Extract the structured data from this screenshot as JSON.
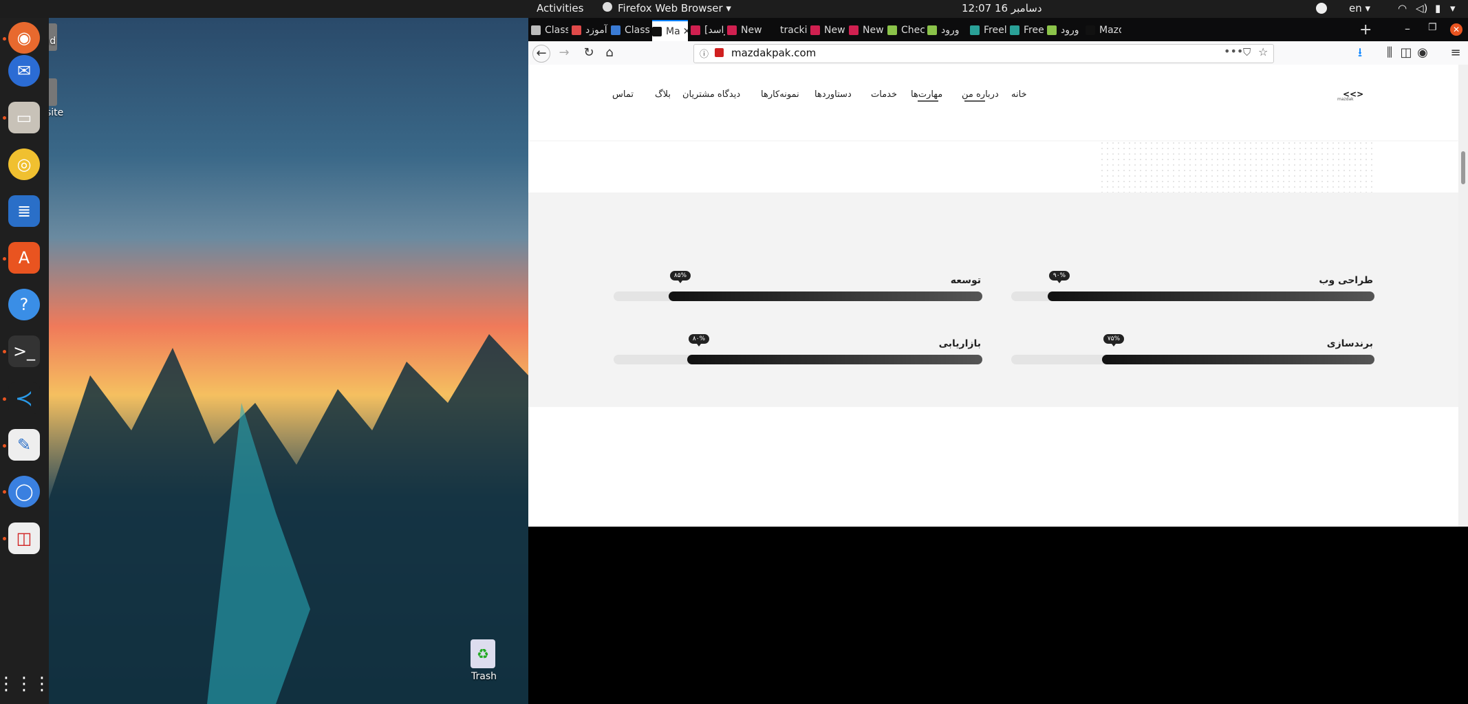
{
  "topbar": {
    "activities": "Activities",
    "app_menu": "Firefox Web Browser ▾",
    "clock": "12:07  16 دسامبر",
    "lang": "en ▾"
  },
  "desktop": {
    "icon1_label": "mmd",
    "icon2_label": "site",
    "trash_label": "Trash"
  },
  "tabs": [
    {
      "label": "Class",
      "color": "#bbb"
    },
    {
      "label": "آموزد",
      "color": "#e04a4a"
    },
    {
      "label": "Class",
      "color": "#3a7bd5"
    },
    {
      "label": "Ma",
      "color": "#111"
    },
    {
      "label": "[راسد",
      "color": "#d02050"
    },
    {
      "label": "New",
      "color": "#d02050"
    },
    {
      "label": "tracking",
      "color": "#0c0c0d"
    },
    {
      "label": "New",
      "color": "#d02050"
    },
    {
      "label": "New",
      "color": "#d02050"
    },
    {
      "label": "Chec",
      "color": "#8bc34a"
    },
    {
      "label": "ورود",
      "color": "#8bc34a"
    },
    {
      "label": "Freel",
      "color": "#2aa198"
    },
    {
      "label": "Freel",
      "color": "#2aa198"
    },
    {
      "label": "ورود",
      "color": "#8bc34a"
    },
    {
      "label": "Mazd",
      "color": "#111"
    }
  ],
  "url": "mazdakpak.com",
  "site": {
    "logo": "mazdak",
    "menu": [
      "خانه",
      "درباره من",
      "مهارت‌ها",
      "خدمات",
      "دستاوردها",
      "نمونه‌کارها",
      "دیدگاه مشتریان",
      "بلاگ",
      "تماس"
    ]
  },
  "skills": [
    {
      "name": "طراحی وب",
      "percent": 90,
      "badge": "۹۰%"
    },
    {
      "name": "توسعه",
      "percent": 85,
      "badge": "۸۵%"
    },
    {
      "name": "برندسازی",
      "percent": 75,
      "badge": "۷۵%"
    },
    {
      "name": "بازاریابی",
      "percent": 80,
      "badge": "۸۰%"
    }
  ],
  "icons": [
    "firefox-icon",
    "thunderbird-icon",
    "files-icon",
    "rhythmbox-icon",
    "writer-icon",
    "software-icon",
    "help-icon",
    "terminal-icon",
    "vscode-icon",
    "text-editor-icon",
    "chromium-icon",
    "document-viewer-icon",
    "apps-grid-icon"
  ]
}
